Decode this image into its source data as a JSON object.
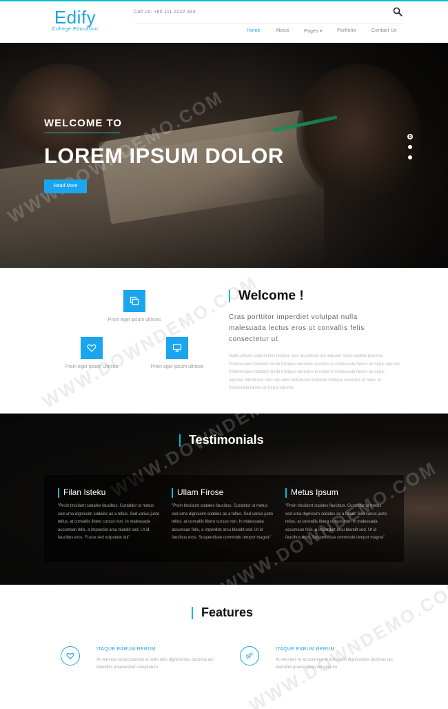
{
  "header": {
    "logo_title": "Edify",
    "logo_subtitle": "College Education",
    "call_text": "Call Us: +80 111 2222 333",
    "nav": [
      {
        "label": "Home",
        "active": true
      },
      {
        "label": "About",
        "active": false
      },
      {
        "label": "Pages ▾",
        "active": false
      },
      {
        "label": "Portfolio",
        "active": false
      },
      {
        "label": "Contact Us",
        "active": false
      }
    ]
  },
  "hero": {
    "welcome": "WELCOME TO",
    "title": "LOREM IPSUM DOLOR",
    "button": "Read More",
    "slides": 3,
    "active_slide": 1
  },
  "welcome_section": {
    "features": [
      {
        "icon": "copy-icon",
        "caption": "Proin eget ipsum ultrices"
      },
      {
        "icon": "heart-icon",
        "caption": "Proin eget ipsum ultrices"
      },
      {
        "icon": "monitor-icon",
        "caption": "Proin eget ipsum ultrices"
      }
    ],
    "title": "Welcome !",
    "lead": "Cras porttitor imperdiet volutpat nulla malesuada lectus eros ut convallis felis consectetur ut",
    "body": "Nulla ultrices justo id felis tempor, quis accumsan dui aliquam sociis sagittis placerat. Pellentesque habitant morbi tristique senectus et netus et malesuada fames ac turpis egestas Pellentesque habitant morbi tristique senectus et netus et malesuada fames ac turpis egestas. Morbi nec odio nec ante sollicitudin interdum tristique senectus et netus et malesuada fames ac turpis egestas"
  },
  "testimonials": {
    "title": "Testimonials",
    "items": [
      {
        "name": "Filan Isteku",
        "text": "\"Proin tincidunt sodales faucibus. Curabitur ut metus sed urna dignissim sodales ac a tellus. Sed varius justo tellus, at convallis libero cursus non. In malesuada accumsan felis, a imperdiet arcu blandit sed. Ut id faucibus eros. Fusce sed vulputate dui\""
      },
      {
        "name": "Ullam Firose",
        "text": "\"Proin tincidunt sodales faucibus. Curabitur ut metus sed urna dignissim sodales ac a tellus. Sed varius justo tellus, at convallis libero cursus non. In malesuada accumsan felis, a imperdiet arcu blandit sed. Ut id faucibus eros. Suspendisse commodo tempor magna\""
      },
      {
        "name": "Metus Ipsum",
        "text": "\"Proin tincidunt sodales faucibus. Curabitur ut metus sed urna dignissim sodales ac a tellus. Sed varius justo tellus, at convallis libero cursus non. In malesuada accumsan felis, a imperdiet arcu blandit sed. Ut id faucibus eros. Suspendisse commodo tempor magna\""
      }
    ]
  },
  "features": {
    "title": "Features",
    "items": [
      {
        "icon": "heart-icon",
        "heading": "ITAQUE EARUM RERUM",
        "text": "At vero eos et accusamus et iusto odio dignissimos ducimus qui blanditiis praesentium voluptatum"
      },
      {
        "icon": "gears-icon",
        "heading": "ITAQUE EARUM RERUM",
        "text": "At vero eos et accusamus et iusto odio dignissimos ducimus qui blanditiis praesentium voluptatum"
      }
    ]
  },
  "watermark": "WWW.DOWNDEMO.COM",
  "colors": {
    "accent": "#00bcd4",
    "brand": "#1aa6ee",
    "dark": "#0b0a09"
  }
}
